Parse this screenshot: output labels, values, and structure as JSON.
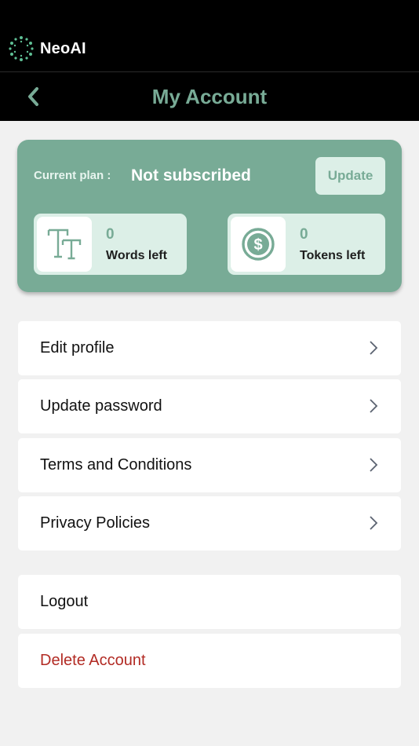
{
  "brand": {
    "name": "NeoAI",
    "logo_icon": "neoai-dotted-ring-logo",
    "accent_color": "#78ab96"
  },
  "header": {
    "title": "My Account",
    "back_icon": "chevron-left-icon"
  },
  "plan": {
    "label": "Current plan :",
    "value": "Not subscribed",
    "update_label": "Update"
  },
  "stats": {
    "words": {
      "count": "0",
      "label": "Words left",
      "icon": "text-size-icon"
    },
    "tokens": {
      "count": "0",
      "label": "Tokens left",
      "icon": "dollar-coin-icon"
    }
  },
  "menu": {
    "edit_profile": "Edit profile",
    "update_password": "Update password",
    "terms": "Terms and Conditions",
    "privacy": "Privacy Policies",
    "logout": "Logout",
    "delete_account": "Delete Account"
  },
  "colors": {
    "danger": "#b22b24",
    "background": "#f1f1f1"
  }
}
